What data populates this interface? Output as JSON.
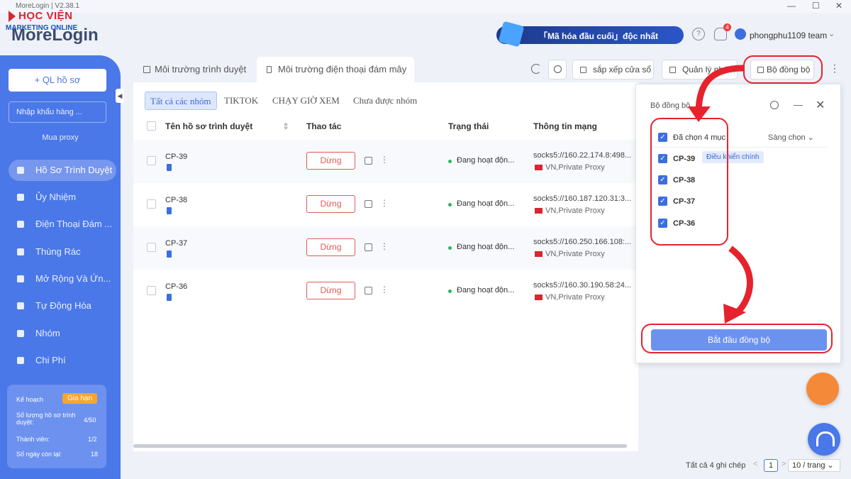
{
  "window": {
    "title": "MoreLogin | V2.38.1",
    "min": "—",
    "max": "☐",
    "close": "✕"
  },
  "watermark": {
    "line1": "HỌC VIỆN",
    "line2": "MARKETING ONLINE",
    "app_name": "MoreLogin"
  },
  "header": {
    "banner": "「Mã hóa đầu cuối」độc nhất",
    "help_icon": "?",
    "notif_count": "4",
    "team": "phongphu1109 team",
    "team_chevron": "⌄"
  },
  "sidebar": {
    "add_profile": "+ QL hồ sơ",
    "import": "Nhập khẩu hàng ...",
    "buy_proxy": "Mua proxy",
    "collapse": "◀",
    "items": [
      {
        "label": "Hồ Sơ Trình Duyệt",
        "icon": "browser-profile-icon"
      },
      {
        "label": "Ủy Nhiệm",
        "icon": "proxy-icon"
      },
      {
        "label": "Điện Thoại Đám ...",
        "icon": "phone-icon"
      },
      {
        "label": "Thùng Rác",
        "icon": "trash-icon"
      },
      {
        "label": "Mở Rộng Và Ứn...",
        "icon": "extension-icon"
      },
      {
        "label": "Tự Động Hóa",
        "icon": "automation-icon"
      },
      {
        "label": "Nhóm",
        "icon": "group-icon"
      },
      {
        "label": "Chi Phí",
        "icon": "billing-icon"
      }
    ],
    "plan": {
      "label": "Kế hoạch",
      "renew": "Gia hạn",
      "profiles_label": "Số lượng hồ sơ trình duyệt:",
      "profiles_value": "4/50",
      "members_label": "Thành viên:",
      "members_value": "1/2",
      "days_label": "Số ngày còn lại:",
      "days_value": "18"
    }
  },
  "tabs": [
    {
      "label": "Môi trường trình duyệt"
    },
    {
      "label": "Môi trường điện thoại đám mây"
    }
  ],
  "toolbar": {
    "arrange": "sắp xếp cửa sổ",
    "manage": "Quản lý nhóm",
    "sync": "Bộ đồng bộ",
    "more": "⋮"
  },
  "groups": [
    "Tất cả các nhóm",
    "TIKTOK",
    "CHẠY GIỜ XEM",
    "Chưa được nhóm"
  ],
  "table": {
    "headers": {
      "name": "Tên hồ sơ trình duyệt",
      "sort": "⇕",
      "action": "Thao tác",
      "status": "Trạng thái",
      "network": "Thông tin mạng"
    },
    "rows": [
      {
        "name": "CP-39",
        "action": "Dừng",
        "status": "Đang hoạt độn...",
        "proxy": "socks5://160.22.174.8:498...",
        "proxy_type": "VN,Private Proxy"
      },
      {
        "name": "CP-38",
        "action": "Dừng",
        "status": "Đang hoạt độn...",
        "proxy": "socks5://160.187.120.31:3...",
        "proxy_type": "VN,Private Proxy"
      },
      {
        "name": "CP-37",
        "action": "Dừng",
        "status": "Đang hoạt độn...",
        "proxy": "socks5://160.250.166.108:...",
        "proxy_type": "VN,Private Proxy"
      },
      {
        "name": "CP-36",
        "action": "Dừng",
        "status": "Đang hoạt độn...",
        "proxy": "socks5://160.30.190.58:24...",
        "proxy_type": "VN,Private Proxy"
      }
    ],
    "row_more": "⋮"
  },
  "pagination": {
    "total": "Tất cả 4 ghi chép",
    "prev": "<",
    "page": "1",
    "next": ">",
    "per_page": "10 / trang ⌄"
  },
  "sync_panel": {
    "title": "Bộ đồng bộ",
    "minimize": "—",
    "close": "✕",
    "selected": "Đã chọn 4 mục",
    "reselect": "Sàng chọn ⌄",
    "check": "✓",
    "items": [
      {
        "name": "CP-39",
        "badge": "Điều khiển chính"
      },
      {
        "name": "CP-38"
      },
      {
        "name": "CP-37"
      },
      {
        "name": "CP-36"
      }
    ],
    "start": "Bắt đầu đồng bộ"
  },
  "colors": {
    "sidebar": "#4a78e8",
    "primary": "#3b6fe0",
    "stop": "#e25b55",
    "highlight": "#e5232e"
  }
}
